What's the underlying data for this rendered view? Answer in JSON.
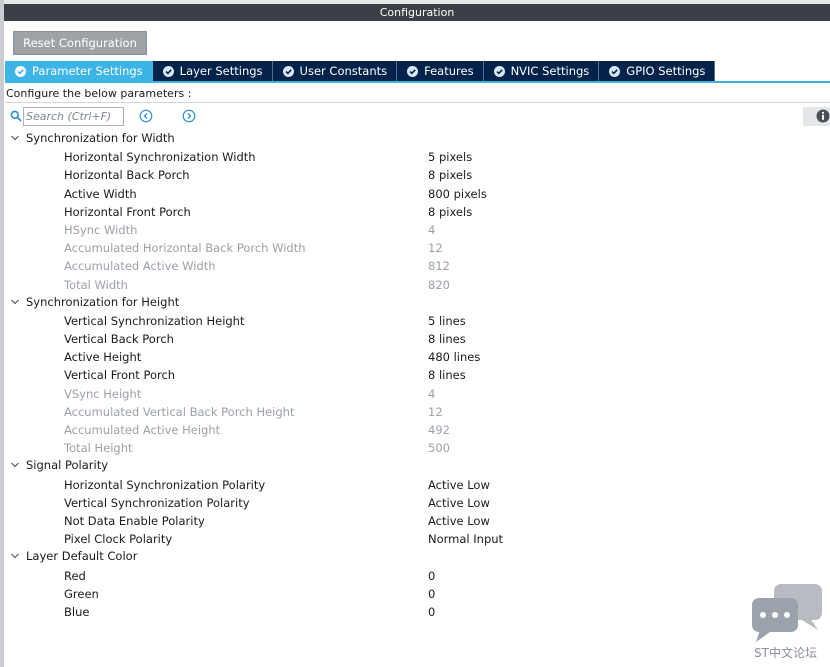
{
  "window": {
    "title": "Configuration"
  },
  "toolbar": {
    "reset_label": "Reset Configuration"
  },
  "tabs": [
    {
      "label": "Parameter Settings",
      "active": true
    },
    {
      "label": "Layer Settings",
      "active": false
    },
    {
      "label": "User Constants",
      "active": false
    },
    {
      "label": "Features",
      "active": false
    },
    {
      "label": "NVIC Settings",
      "active": false
    },
    {
      "label": "GPIO Settings",
      "active": false
    }
  ],
  "hint": "Configure the below parameters :",
  "search": {
    "placeholder": "Search (Ctrl+F)"
  },
  "icons": {
    "tab_check": "check-circle-icon",
    "search": "search-icon",
    "prev": "chevron-left-circle-icon",
    "next": "chevron-right-circle-icon",
    "info": "info-icon",
    "group_toggle": "chevron-down-icon",
    "watermark": "chat-bubble-icon"
  },
  "colors": {
    "tab_active": "#3cb4e6",
    "tab_inactive": "#03234b",
    "title_bar": "#3c4046",
    "disabled_text": "#9aa1a8",
    "accent": "#3cb4e6"
  },
  "groups": [
    {
      "title": "Synchronization for Width",
      "params": [
        {
          "name": "Horizontal Synchronization Width",
          "value": "5 pixels",
          "disabled": false
        },
        {
          "name": "Horizontal Back Porch",
          "value": "8 pixels",
          "disabled": false
        },
        {
          "name": "Active Width",
          "value": "800 pixels",
          "disabled": false
        },
        {
          "name": "Horizontal Front Porch",
          "value": "8 pixels",
          "disabled": false
        },
        {
          "name": "HSync Width",
          "value": "4",
          "disabled": true
        },
        {
          "name": "Accumulated Horizontal Back Porch Width",
          "value": "12",
          "disabled": true
        },
        {
          "name": "Accumulated Active Width",
          "value": "812",
          "disabled": true
        },
        {
          "name": "Total Width",
          "value": "820",
          "disabled": true
        }
      ]
    },
    {
      "title": "Synchronization for Height",
      "params": [
        {
          "name": "Vertical Synchronization Height",
          "value": "5 lines",
          "disabled": false
        },
        {
          "name": "Vertical Back Porch",
          "value": "8 lines",
          "disabled": false
        },
        {
          "name": "Active Height",
          "value": "480 lines",
          "disabled": false
        },
        {
          "name": "Vertical Front Porch",
          "value": "8 lines",
          "disabled": false
        },
        {
          "name": "VSync Height",
          "value": "4",
          "disabled": true
        },
        {
          "name": "Accumulated Vertical Back Porch Height",
          "value": "12",
          "disabled": true
        },
        {
          "name": "Accumulated Active Height",
          "value": "492",
          "disabled": true
        },
        {
          "name": "Total Height",
          "value": "500",
          "disabled": true
        }
      ]
    },
    {
      "title": "Signal Polarity",
      "params": [
        {
          "name": "Horizontal Synchronization Polarity",
          "value": "Active Low",
          "disabled": false
        },
        {
          "name": "Vertical Synchronization Polarity",
          "value": "Active Low",
          "disabled": false
        },
        {
          "name": "Not Data Enable Polarity",
          "value": "Active Low",
          "disabled": false
        },
        {
          "name": "Pixel Clock Polarity",
          "value": "Normal Input",
          "disabled": false
        }
      ]
    },
    {
      "title": "Layer Default Color",
      "params": [
        {
          "name": "Red",
          "value": "0",
          "disabled": false
        },
        {
          "name": "Green",
          "value": "0",
          "disabled": false
        },
        {
          "name": "Blue",
          "value": "0",
          "disabled": false
        }
      ]
    }
  ],
  "watermark": {
    "text": "ST中文论坛"
  }
}
